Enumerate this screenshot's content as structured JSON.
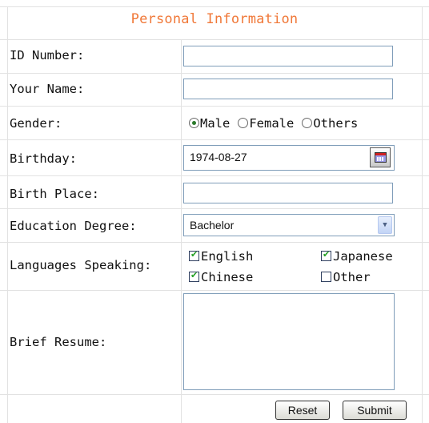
{
  "form": {
    "title": "Personal Information",
    "fields": {
      "id_number": {
        "label": "ID Number:",
        "value": ""
      },
      "your_name": {
        "label": "Your Name:",
        "value": ""
      },
      "gender": {
        "label": "Gender:",
        "options": [
          "Male",
          "Female",
          "Others"
        ],
        "selected": "Male"
      },
      "birthday": {
        "label": "Birthday:",
        "value": "1974-08-27",
        "icon": "calendar-icon"
      },
      "birth_place": {
        "label": "Birth Place:",
        "value": ""
      },
      "education": {
        "label": "Education Degree:",
        "value": "Bachelor"
      },
      "languages": {
        "label": "Languages Speaking:",
        "options": [
          {
            "label": "English",
            "checked": true
          },
          {
            "label": "Japanese",
            "checked": true
          },
          {
            "label": "Chinese",
            "checked": true
          },
          {
            "label": "Other",
            "checked": false
          }
        ]
      },
      "resume": {
        "label": "Brief Resume:",
        "value": ""
      }
    },
    "buttons": {
      "reset": "Reset",
      "submit": "Submit"
    }
  },
  "colors": {
    "title": "#f07838",
    "grid": "#e2e2e2",
    "input_border": "#7f9db9"
  }
}
